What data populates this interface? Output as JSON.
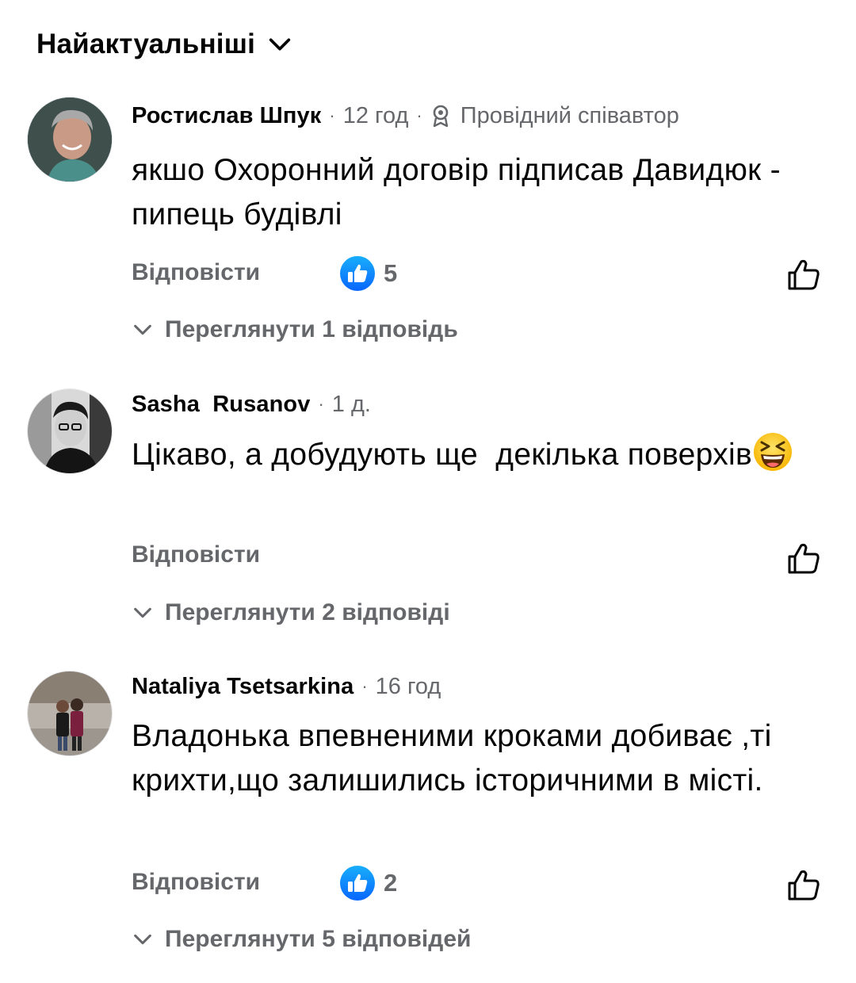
{
  "sort": {
    "label": "Найактуальніші",
    "chevron_icon": "chevron-down-icon"
  },
  "comments": [
    {
      "author": "Ростислав Шпук",
      "time": "12 год",
      "badge": "Провідний співавтор",
      "badge_icon": "top-contributor-icon",
      "text": "якшо Охоронний договір підписав Давидюк - пипець будівлі",
      "reply_label": "Відповісти",
      "reaction_icon": "like-reaction-icon",
      "reaction_count": "5",
      "view_replies": "Переглянути 1 відповідь"
    },
    {
      "author": "Sasha  Rusanov",
      "time": "1 д.",
      "text": "Цікаво, а добудують ще  декілька поверхів",
      "emoji": "laughing-squinting-face-emoji",
      "reply_label": "Відповісти",
      "view_replies": "Переглянути 2 відповіді"
    },
    {
      "author": "Nataliya Tsetsarkina",
      "time": "16 год",
      "text": "Владонька впевненими кроками добиває ,ті крихти,що залишились історичними в місті.",
      "reply_label": "Відповісти",
      "reaction_icon": "like-reaction-icon",
      "reaction_count": "2",
      "view_replies": "Переглянути 5 відповідей"
    }
  ],
  "colors": {
    "text_primary": "#050505",
    "text_secondary": "#65676b",
    "like_blue": "#1877f2",
    "background": "#ffffff"
  }
}
